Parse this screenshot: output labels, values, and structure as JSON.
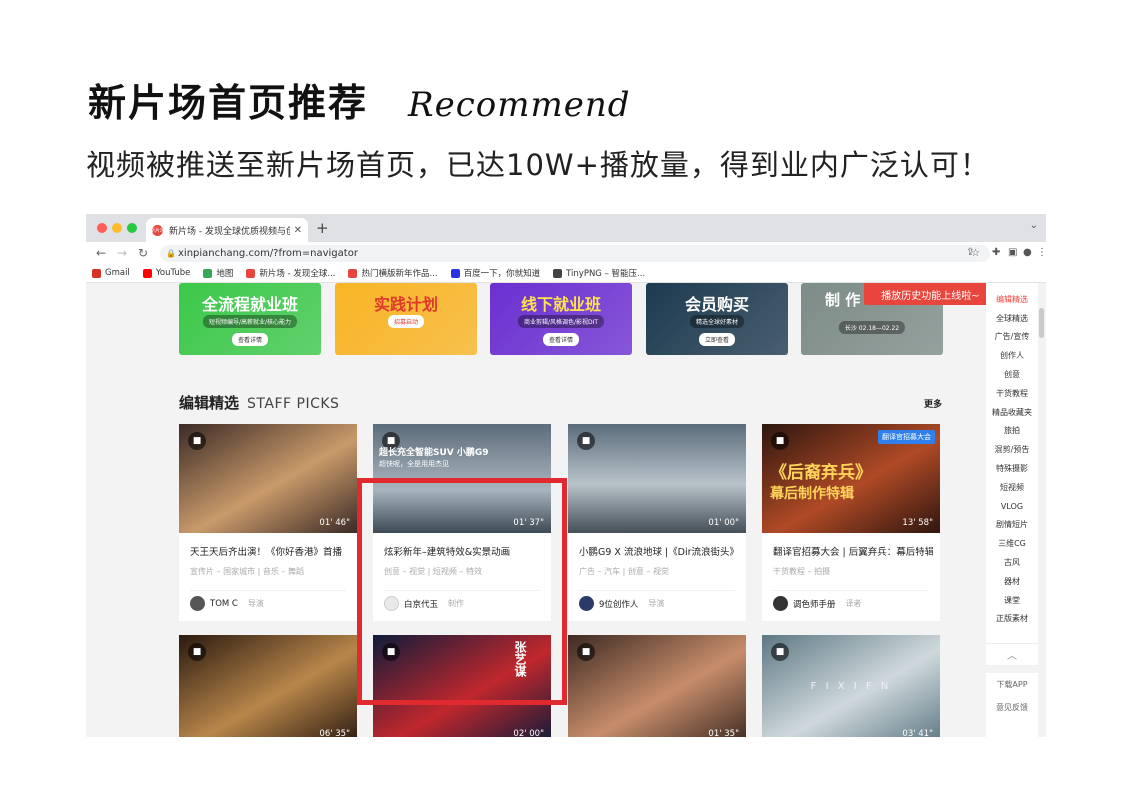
{
  "heading": {
    "zh": "新片场首页推荐",
    "en": "Recommend"
  },
  "subheading": "视频被推送至新片场首页，已达10W+播放量，得到业内广泛认可！",
  "browser": {
    "tab_title": "新片场 - 发现全球优质视频与创作人",
    "tab_favicon": "新片场",
    "url": "xinpianchang.com/?from=navigator",
    "bookmarks": [
      {
        "label": "Gmail",
        "color": "#d93025"
      },
      {
        "label": "YouTube",
        "color": "#ff0000"
      },
      {
        "label": "地图",
        "color": "#34a853"
      },
      {
        "label": "新片场 - 发现全球...",
        "color": "#e8453c"
      },
      {
        "label": "热门横版新年作品...",
        "color": "#e8453c"
      },
      {
        "label": "百度一下，你就知道",
        "color": "#2932e1"
      },
      {
        "label": "TinyPNG – 智能压...",
        "color": "#444444"
      }
    ]
  },
  "banners": [
    {
      "title": "全流程就业班",
      "sub": "短视频编导/高薪就业/核心能力",
      "button": "查看详情",
      "bg": "#3cc84a",
      "fg": "#ffffff"
    },
    {
      "title": "实践计划",
      "sub": "招募启动",
      "button": "",
      "bg": "#f8b424",
      "fg": "#e0382b"
    },
    {
      "title": "线下就业班",
      "sub": "商业剪辑/风格调色/影视DIT",
      "button": "查看详情",
      "bg": "#6b2fd1",
      "fg": "#ffe34d"
    },
    {
      "title": "会员购买",
      "sub": "精选全球好素材",
      "button": "立即查看",
      "bg": "#1d3a4f",
      "fg": "#ffffff"
    },
    {
      "title": "制 作",
      "sub": "长沙 02.18—02.22",
      "button": "",
      "bg": "#7d8c88",
      "fg": "#ffffff"
    }
  ],
  "toast": "播放历史功能上线啦~",
  "section": {
    "title_zh": "编辑精选",
    "title_en": "STAFF PICKS",
    "more": "更多"
  },
  "cards": [
    {
      "title": "天王天后齐出演！《你好香港》首播",
      "tags": "宣传片 – 国家城市  |  音乐 – 舞蹈",
      "author": "TOM C",
      "role": "导演",
      "duration": "01' 46\"",
      "c1": "#3b2a26",
      "c2": "#c99a6a",
      "av": "#555555"
    },
    {
      "title": "炫彩新年–建筑特效&实景动画",
      "tags": "创意 – 视觉  |  短视频 – 特效",
      "author": "白京代玉",
      "role": "制作",
      "duration": "01' 37\"",
      "c1": "#4f79c8",
      "c2": "#c43c3c",
      "av": "#e9e9e9"
    },
    {
      "title": "小鹏G9 X 流浪地球 |《Dir流浪街头》",
      "tags": "广告 – 汽车  |  创意 – 视觉",
      "author": "9位创作人",
      "role": "导演",
      "duration": "01' 00\"",
      "c1": "#2f3b46",
      "c2": "#9ba7b1",
      "av": "#2a3a6a"
    },
    {
      "title": "翻译官招募大会 | 后翼弃兵：幕后特辑",
      "tags": "干货教程 – 拍摄",
      "author": "调色师手册",
      "role": "译者",
      "duration": "13' 58\"",
      "c1": "#2e160f",
      "c2": "#b04a26",
      "av": "#333333"
    },
    {
      "title": "",
      "tags": "",
      "author": "",
      "role": "",
      "duration": "06' 35\"",
      "c1": "#2a1a10",
      "c2": "#b8864a",
      "av": "#555555"
    },
    {
      "title": "",
      "tags": "",
      "author": "",
      "role": "",
      "duration": "02' 00\"",
      "c1": "#0f1c3a",
      "c2": "#c0272d",
      "av": "#555555"
    },
    {
      "title": "",
      "tags": "",
      "author": "",
      "role": "",
      "duration": "01' 35\"",
      "c1": "#3d2a22",
      "c2": "#c78d6b",
      "av": "#555555"
    },
    {
      "title": "",
      "tags": "",
      "author": "",
      "role": "",
      "duration": "03' 41\"",
      "c1": "#5e7884",
      "c2": "#cfd9dc",
      "av": "#555555"
    }
  ],
  "card4_badge": "翻译官招募大会",
  "card4_overlay": {
    "l1": "《后裔弃兵》",
    "l2": "幕后制作特辑"
  },
  "card2_overlay": {
    "l1": "超长充全智能SUV 小鹏G9",
    "l2": "超快呢，全是用用杰见"
  },
  "card6_overlay": "张艺谋",
  "card8_overlay": "F I X I F N",
  "sidebar": {
    "items": [
      "编辑精选",
      "全球精选",
      "广告/宣传",
      "创作人",
      "创意",
      "干货教程",
      "精品收藏夹",
      "旅拍",
      "混剪/预告",
      "特殊摄影",
      "短视频",
      "VLOG",
      "剧情短片",
      "三维CG",
      "古风",
      "器材",
      "课堂",
      "正版素材"
    ],
    "up": "︿",
    "bottom": [
      "下载APP",
      "意见反馈"
    ]
  }
}
